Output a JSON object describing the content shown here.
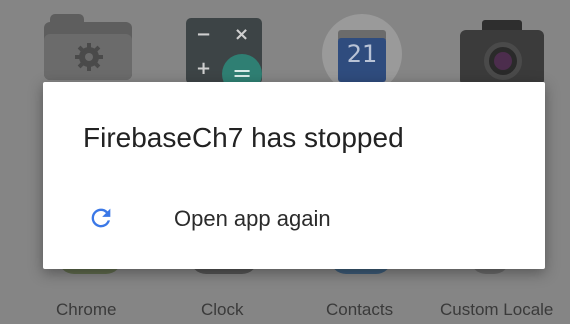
{
  "home_screen": {
    "calendar_day": "21",
    "calculator_symbols": {
      "minus": "−",
      "times": "×",
      "plus": "+",
      "equals": "="
    },
    "app_labels": [
      "Chrome",
      "Clock",
      "Contacts",
      "Custom Locale"
    ]
  },
  "dialog": {
    "title": "FirebaseCh7 has stopped",
    "option_label": "Open app again",
    "option_icon": "refresh-icon",
    "accent_color": "#3b78e7"
  },
  "colors": {
    "dim_background": "#858585",
    "dialog_background": "#ffffff"
  }
}
